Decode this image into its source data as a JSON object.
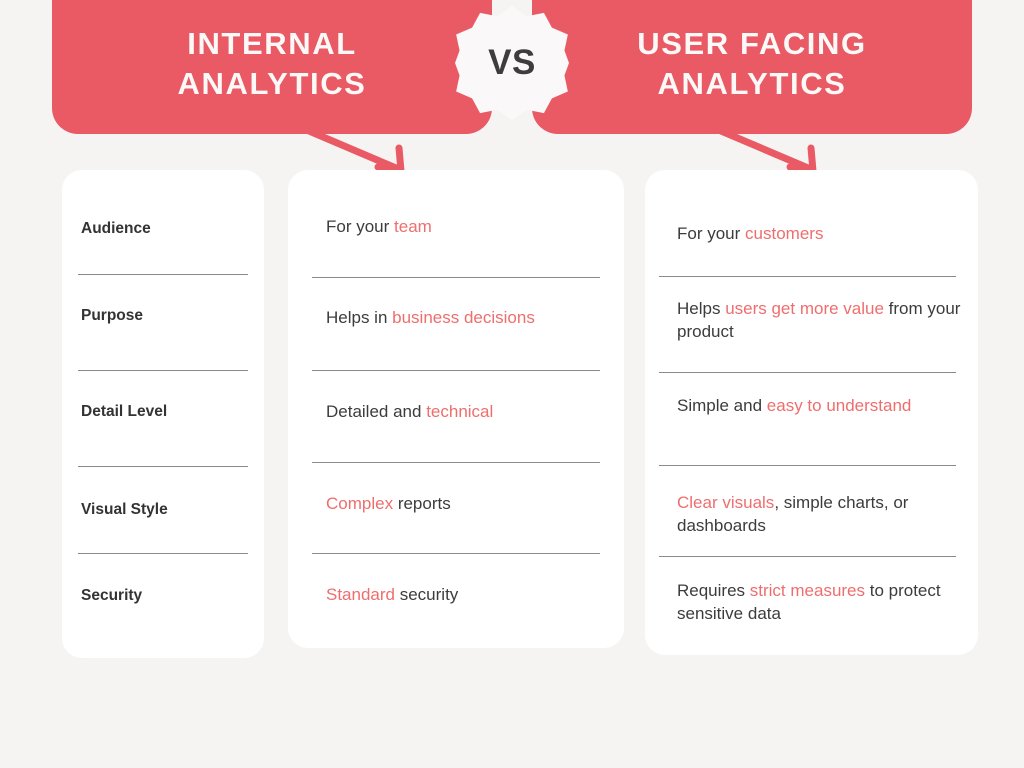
{
  "theme": {
    "banner_red": "#e95a64",
    "accent_red": "#ee6e6e",
    "page_background": "#f5f4f3",
    "card_background": "#ffffff",
    "text_dark": "#3c3c3c",
    "divider": "#8a8a8a"
  },
  "header": {
    "left_title": "INTERNAL\nANALYTICS",
    "right_title": "USER FACING\nANALYTICS",
    "vs_label": "VS"
  },
  "comparison": {
    "labels": [
      {
        "text": "Audience"
      },
      {
        "text": "Purpose"
      },
      {
        "text": "Detail Level"
      },
      {
        "text": "Visual Style"
      },
      {
        "text": "Security"
      }
    ],
    "internal": [
      {
        "plain_1": "For your ",
        "highlight": "team",
        "plain_2": ""
      },
      {
        "plain_1": "Helps in ",
        "highlight": "business decisions",
        "plain_2": ""
      },
      {
        "plain_1": "Detailed and ",
        "highlight": "technical",
        "plain_2": ""
      },
      {
        "plain_1": "",
        "highlight": "Complex",
        "plain_2": " reports"
      },
      {
        "plain_1": "",
        "highlight": "Standard",
        "plain_2": " security"
      }
    ],
    "user_facing": [
      {
        "plain_1": "For your ",
        "highlight": "customers",
        "plain_2": ""
      },
      {
        "plain_1": "Helps ",
        "highlight": "users get more value",
        "plain_2": " from your product"
      },
      {
        "plain_1": "Simple and ",
        "highlight": "easy to understand",
        "plain_2": ""
      },
      {
        "plain_1": "",
        "highlight": "Clear visuals",
        "plain_2": ", simple charts, or dashboards"
      },
      {
        "plain_1": "Requires ",
        "highlight": "strict measures",
        "plain_2": " to protect sensitive data"
      }
    ]
  }
}
